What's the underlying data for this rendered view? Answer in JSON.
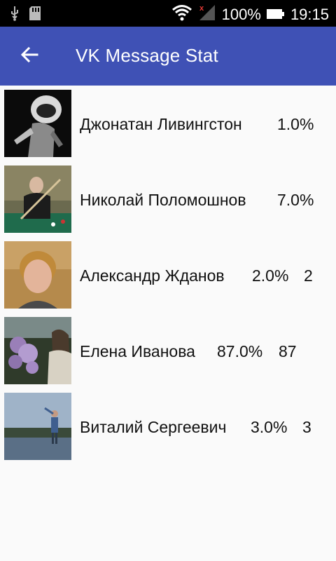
{
  "status_bar": {
    "battery_percent": "100%",
    "time": "19:15",
    "icons": [
      "usb-icon",
      "sd-card-icon",
      "wifi-icon",
      "no-signal-icon",
      "battery-icon"
    ]
  },
  "app_bar": {
    "title": "VK Message Stat",
    "back_icon": "arrow-back-icon",
    "color": "#3f51b5"
  },
  "contacts": [
    {
      "name": "Джонатан Ливингстон",
      "percent": "1.0%",
      "count": ""
    },
    {
      "name": "Николай Поломошнов",
      "percent": "7.0%",
      "count": ""
    },
    {
      "name": "Александр Жданов",
      "percent": "2.0%",
      "count": "2"
    },
    {
      "name": "Елена Иванова",
      "percent": "87.0%",
      "count": "87"
    },
    {
      "name": "Виталий Сергеевич",
      "percent": "3.0%",
      "count": "3"
    }
  ]
}
